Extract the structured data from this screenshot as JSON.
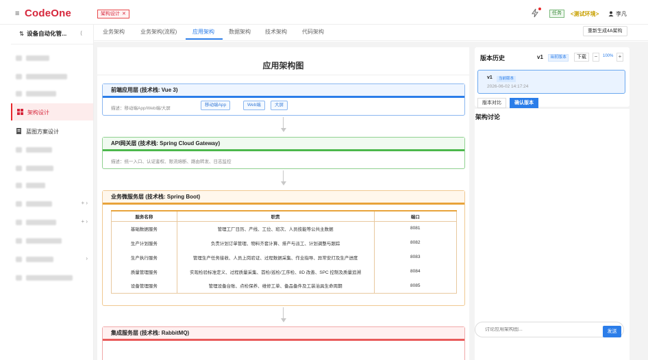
{
  "header": {
    "logo": "CodeOne",
    "breadcrumb_tag": "架构设计",
    "task_badge": "任务",
    "env_label": "<测试环境>",
    "user_name": "李凡"
  },
  "sidebar": {
    "project": "设备自动化管...",
    "active_item": "架构设计",
    "blueprint_item": "蓝图方案设计"
  },
  "tabs": [
    {
      "label": "业务架构"
    },
    {
      "label": "业务架构(流程)"
    },
    {
      "label": "应用架构"
    },
    {
      "label": "数据架构"
    },
    {
      "label": "技术架构"
    },
    {
      "label": "代码架构"
    }
  ],
  "regen_button": "重新生成4A架构",
  "diagram": {
    "title": "应用架构图",
    "frontend": {
      "title": "前端应用层 (技术栈: Vue 3)",
      "desc": "描述：移动端App/Web端/大屏",
      "chips": [
        "移动端App",
        "Web端",
        "大屏"
      ]
    },
    "gateway": {
      "title": "API网关层 (技术栈: Spring Cloud Gateway)",
      "desc": "描述：统一入口、认证鉴权、限流熔断、路由转发、日志监控"
    },
    "micro": {
      "title": "业务微服务层 (技术栈: Spring Boot)",
      "columns": [
        "服务名称",
        "职责",
        "端口"
      ],
      "rows": [
        {
          "name": "基础数据服务",
          "duty": "管理工厂日历、产线、工位、班次、人员技能等公共主数据",
          "port": "8081"
        },
        {
          "name": "生产计划服务",
          "duty": "负责计划订单管理、物料齐套计算、排产与派工、计划调整与跟踪",
          "port": "8082"
        },
        {
          "name": "生产执行服务",
          "duty": "管理生产任务接收、人员上岗验证、过程数据采集、作业指导、异常安灯及生产进度",
          "port": "8083"
        },
        {
          "name": "质量管理服务",
          "duty": "实现检验标准定义、过程质量采集、首检/巡检/工序检、8D 改善、SPC 控制及质量追溯",
          "port": "8084"
        },
        {
          "name": "设备管理服务",
          "duty": "管理设备台账、点检保养、维修工单、备品备件及工装治具生命周期",
          "port": "8085"
        }
      ]
    },
    "integration": {
      "title": "集成服务层 (技术栈: RabbitMQ)"
    }
  },
  "version_panel": {
    "title": "版本历史",
    "version": "v1",
    "current_tag": "当前版本",
    "download": "下载",
    "zoom": "100%",
    "item": {
      "version": "v1",
      "tag": "当前版本",
      "date": "2026-06-02 14:17:24"
    },
    "compare": "版本对比",
    "confirm": "确认版本"
  },
  "discussion": {
    "title": "架构讨论",
    "placeholder": "讨论应用架构图...",
    "send": "发送"
  },
  "colors": {
    "brand": "#d6263b",
    "accent": "#2b7de9",
    "frontend": "#2b7de9",
    "gateway": "#4cb84c",
    "micro": "#e8a33a",
    "integration": "#e85a5a"
  }
}
